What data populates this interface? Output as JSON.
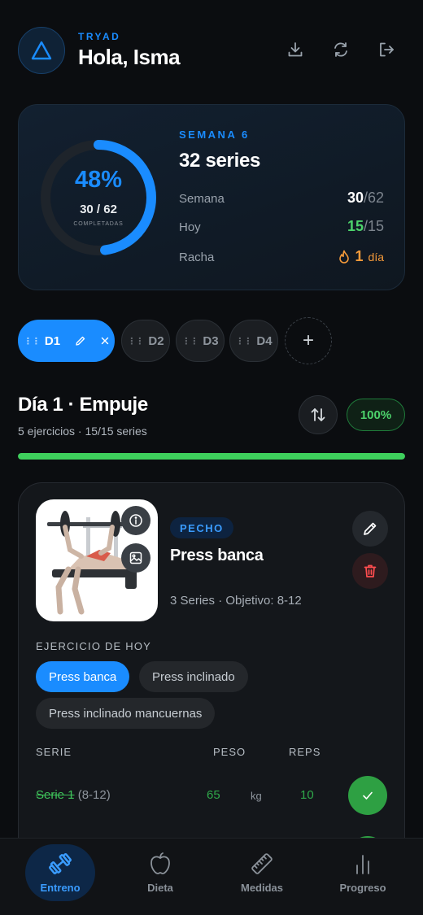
{
  "header": {
    "brand": "TRYAD",
    "greeting": "Hola, Isma",
    "icons": [
      "download-icon",
      "refresh-icon",
      "logout-icon"
    ]
  },
  "stats": {
    "percent_text": "48%",
    "percent_value": 0.48,
    "count_text": "30 / 62",
    "count_sub": "COMPLETADAS",
    "week_label": "SEMANA 6",
    "series_title": "32 series",
    "rows": [
      {
        "label": "Semana",
        "value": "30",
        "total": "/62"
      },
      {
        "label": "Hoy",
        "value": "15",
        "total": "/15"
      },
      {
        "label": "Racha",
        "value": "1",
        "unit": "día"
      }
    ]
  },
  "day_tabs": [
    {
      "label": "D1",
      "active": true
    },
    {
      "label": "D2",
      "active": false
    },
    {
      "label": "D3",
      "active": false
    },
    {
      "label": "D4",
      "active": false
    }
  ],
  "day": {
    "title": "Día 1 · Empuje",
    "subtitle": "5 ejercicios · 15/15 series",
    "percent_badge": "100%",
    "progress": 1.0
  },
  "exercise": {
    "muscle": "PECHO",
    "name": "Press banca",
    "meta": "3 Series · Objetivo: 8-12",
    "today_label": "EJERCICIO DE HOY",
    "variants": [
      {
        "label": "Press banca",
        "active": true
      },
      {
        "label": "Press inclinado",
        "active": false
      },
      {
        "label": "Press inclinado mancuernas",
        "active": false
      }
    ],
    "columns": {
      "serie": "SERIE",
      "peso": "PESO",
      "reps": "REPS"
    },
    "sets": [
      {
        "label": "Serie 1",
        "range": "(8-12)",
        "weight": "65",
        "unit": "kg",
        "reps": "10",
        "done": true
      }
    ]
  },
  "nav": [
    {
      "label": "Entreno",
      "icon": "dumbbell-icon",
      "active": true
    },
    {
      "label": "Dieta",
      "icon": "apple-icon",
      "active": false
    },
    {
      "label": "Medidas",
      "icon": "ruler-icon",
      "active": false
    },
    {
      "label": "Progreso",
      "icon": "bar-chart-icon",
      "active": false
    }
  ],
  "colors": {
    "accent": "#1a8cff",
    "success": "#3ecf5c",
    "streak": "#f59a3a",
    "danger": "#ff4d4f"
  }
}
